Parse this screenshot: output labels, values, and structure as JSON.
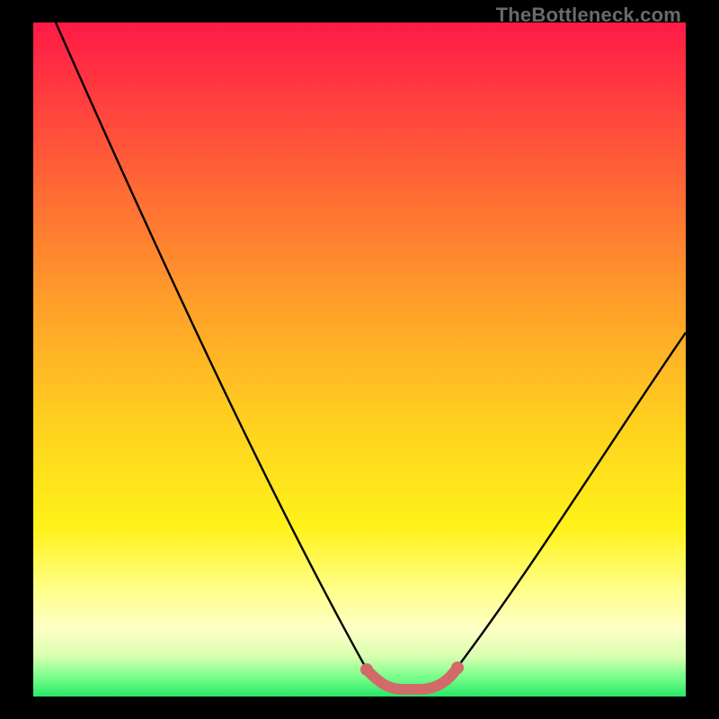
{
  "watermark": "TheBottleneck.com",
  "colors": {
    "gradient_top": "#ff1a47",
    "gradient_mid_upper": "#ff6a35",
    "gradient_mid": "#ffd21f",
    "gradient_mid_lower": "#ffff88",
    "gradient_bottom": "#28e86a",
    "curve_stroke": "#000000",
    "accent_stroke": "#d36a6a",
    "frame_bg": "#000000"
  },
  "chart_data": {
    "type": "line",
    "title": "",
    "xlabel": "",
    "ylabel": "",
    "xlim": [
      0,
      100
    ],
    "ylim": [
      0,
      100
    ],
    "grid": false,
    "series": [
      {
        "name": "bottleneck-curve",
        "x": [
          0,
          5,
          10,
          15,
          20,
          25,
          30,
          35,
          40,
          45,
          50,
          55,
          58,
          60,
          62,
          65,
          70,
          75,
          80,
          85,
          90,
          95,
          100
        ],
        "y_pct": [
          100,
          91,
          82,
          73,
          64,
          55,
          46,
          37,
          28,
          19,
          10,
          4,
          1,
          0,
          0,
          1,
          6,
          14,
          23,
          32,
          41,
          50,
          59
        ]
      },
      {
        "name": "bottom-flat-accent",
        "x": [
          55,
          56,
          57,
          58,
          59,
          60,
          61,
          62,
          63,
          64,
          65,
          66
        ],
        "y_pct": [
          1.4,
          1.0,
          0.7,
          0.5,
          0.4,
          0.4,
          0.4,
          0.5,
          0.7,
          1.0,
          1.4,
          2.0
        ]
      }
    ],
    "annotations": []
  }
}
